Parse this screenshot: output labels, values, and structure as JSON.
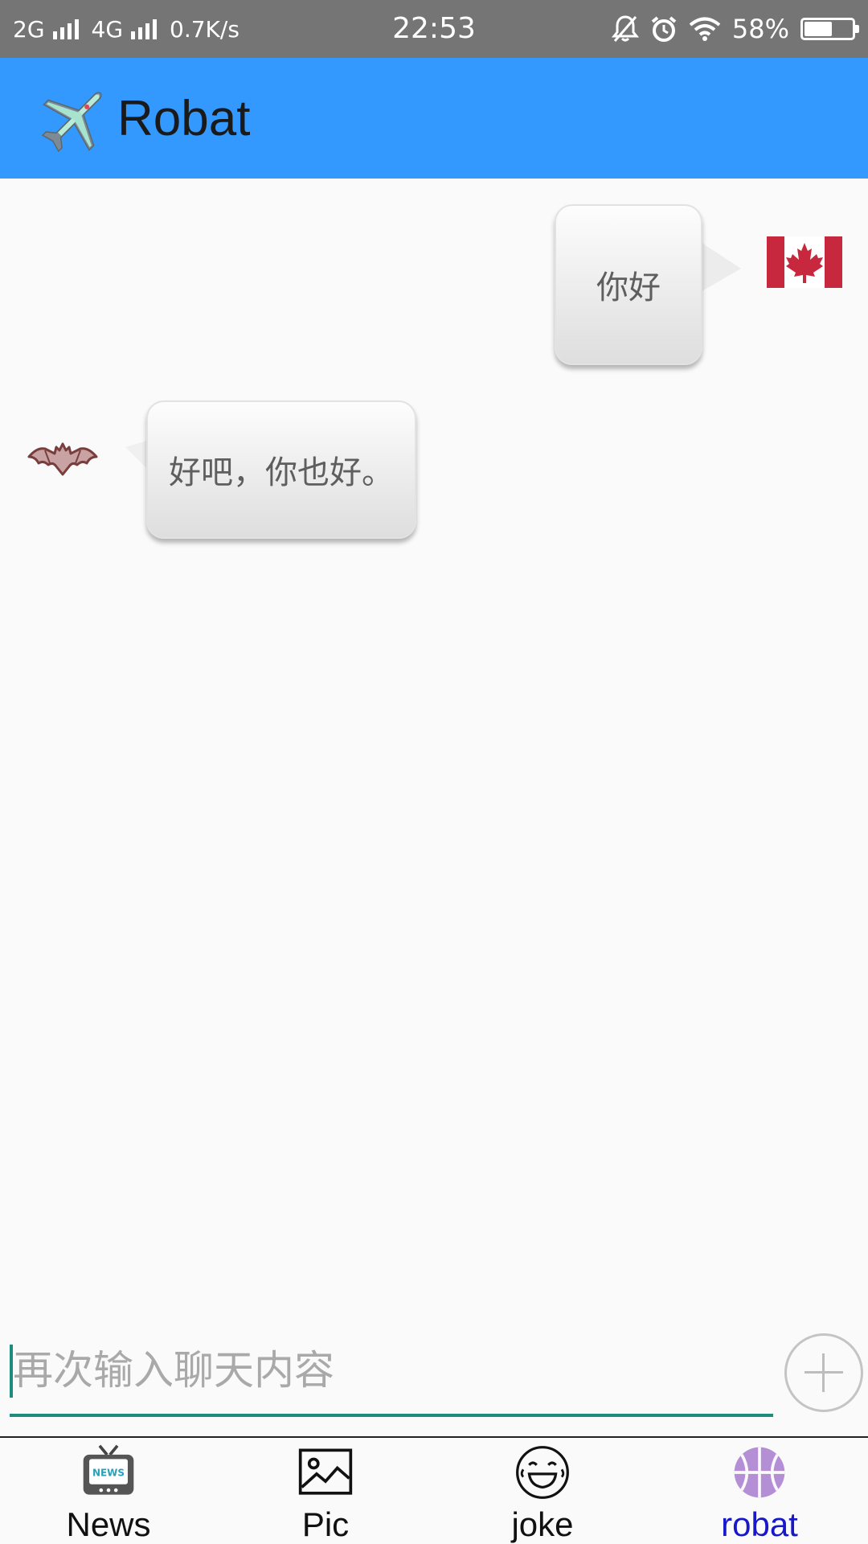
{
  "status_bar": {
    "network1": "2G",
    "network2": "4G",
    "speed": "0.7K/s",
    "time": "22:53",
    "battery": "58%",
    "battery_level": 0.58,
    "icons": [
      "signal-icon",
      "notification-off-icon",
      "alarm-icon",
      "wifi-icon",
      "battery-icon"
    ]
  },
  "app_bar": {
    "title": "Robat",
    "logo_icon": "airplane-icon",
    "color": "#3399ff"
  },
  "chat": {
    "messages": [
      {
        "from": "user",
        "text": "你好",
        "avatar_icon": "canada-flag-icon"
      },
      {
        "from": "bot",
        "text": "好吧，你也好。",
        "avatar_icon": "bat-icon"
      }
    ]
  },
  "input": {
    "placeholder": "再次输入聊天内容",
    "value": "",
    "accent": "#1e8c7e",
    "add_icon": "plus-circle-icon"
  },
  "bottom_nav": {
    "items": [
      {
        "label": "News",
        "icon": "news-tv-icon",
        "active": false
      },
      {
        "label": "Pic",
        "icon": "picture-icon",
        "active": false
      },
      {
        "label": "joke",
        "icon": "laughing-face-icon",
        "active": false
      },
      {
        "label": "robat",
        "icon": "basketball-icon",
        "active": true
      }
    ],
    "active_color": "#1818c8"
  }
}
